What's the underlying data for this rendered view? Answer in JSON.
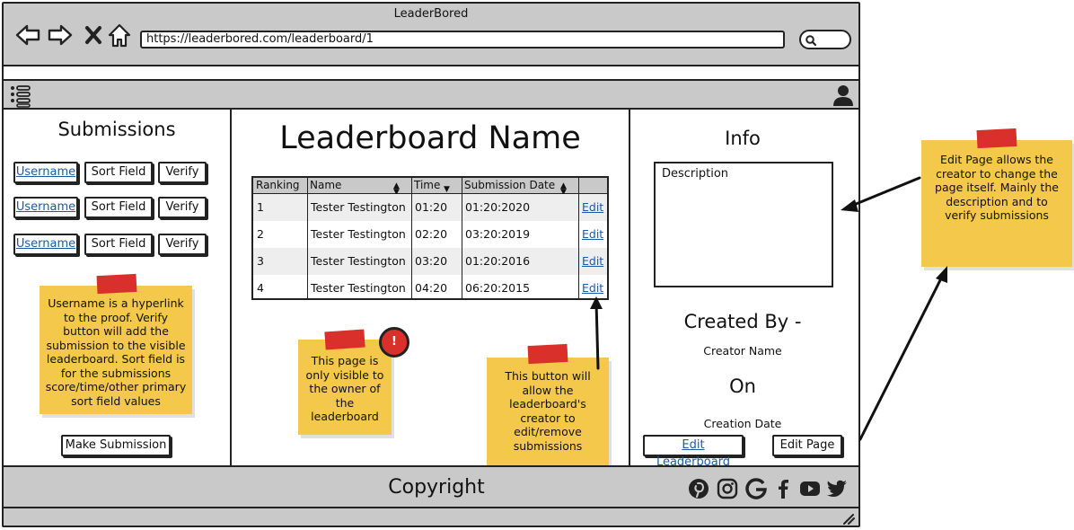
{
  "browser": {
    "title": "LeaderBored",
    "url": "https://leaderbored.com/leaderboard/1"
  },
  "submissions": {
    "heading": "Submissions",
    "rows": [
      {
        "username": "Username",
        "sort_field": "Sort Field",
        "verify": "Verify"
      },
      {
        "username": "Username",
        "sort_field": "Sort Field",
        "verify": "Verify"
      },
      {
        "username": "Username",
        "sort_field": "Sort Field",
        "verify": "Verify"
      }
    ],
    "note": "Username is a hyperlink to the proof. Verify button will add the submission to the visible leaderboard. Sort field is for the submissions score/time/other primary sort field values",
    "make_submission": "Make Submission"
  },
  "leaderboard": {
    "title": "Leaderboard Name",
    "headers": [
      "Ranking",
      "Name",
      "Time",
      "Submission Date"
    ],
    "rows": [
      {
        "rank": "1",
        "name": "Tester Testington",
        "time": "01:20",
        "date": "01:20:2020",
        "action": "Edit"
      },
      {
        "rank": "2",
        "name": "Tester Testington",
        "time": "02:20",
        "date": "03:20:2019",
        "action": "Edit"
      },
      {
        "rank": "3",
        "name": "Tester Testington",
        "time": "03:20",
        "date": "01:20:2016",
        "action": "Edit"
      },
      {
        "rank": "4",
        "name": "Tester Testington",
        "time": "04:20",
        "date": "06:20:2015",
        "action": "Edit"
      }
    ],
    "owner_note": "This page is only visible to the owner of the leaderboard",
    "alert_badge": "!",
    "edit_note": "This button will allow the leaderboard's creator to edit/remove submissions"
  },
  "info": {
    "heading": "Info",
    "description_label": "Description",
    "created_by": "Created By -",
    "creator_name": "Creator Name",
    "on": "On",
    "creation_date": "Creation Date",
    "edit_leaderboard": "Edit Leaderboard",
    "edit_page": "Edit Page"
  },
  "side_note": "Edit Page allows the creator to change the page itself. Mainly the description and to verify submissions",
  "footer": {
    "copyright": "Copyright",
    "social_icons": [
      "pinterest-icon",
      "instagram-icon",
      "google-icon",
      "facebook-icon",
      "youtube-icon",
      "twitter-icon"
    ]
  },
  "colors": {
    "chrome_gray": "#c9c9c9",
    "sticky_yellow": "#f4c84a",
    "tape_red": "#d9302c",
    "link_blue": "#1a5aa8"
  }
}
